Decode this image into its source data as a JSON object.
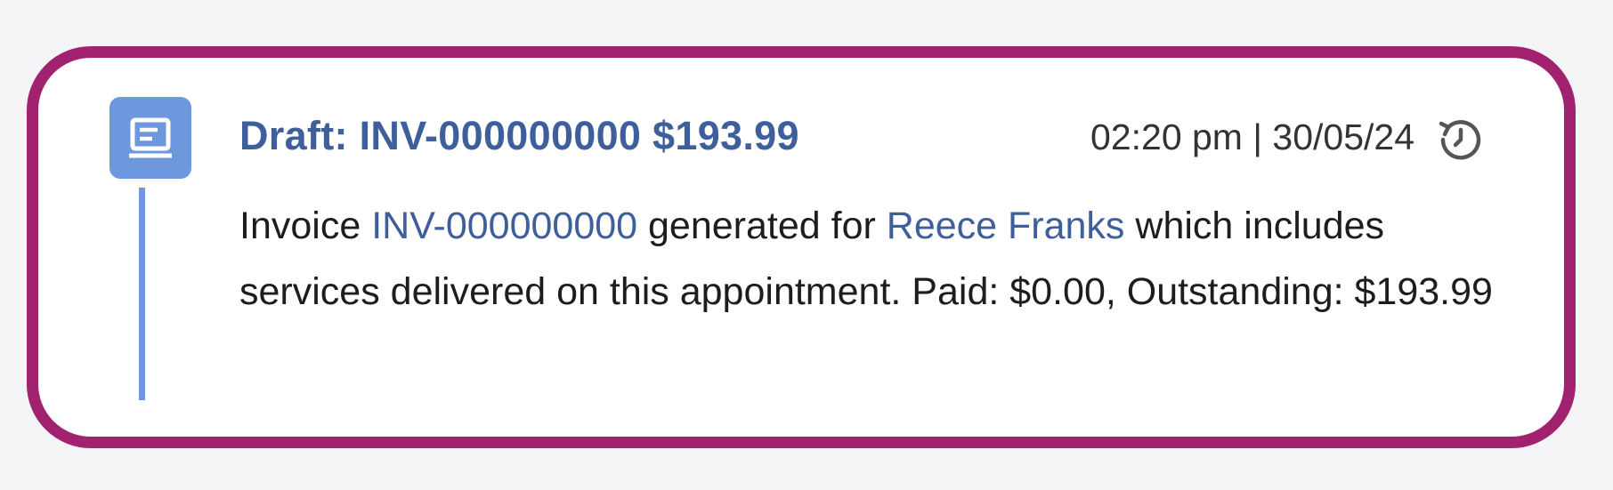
{
  "entry": {
    "icon": "invoice-icon",
    "title": "Draft: INV-000000000 $193.99",
    "timestamp": "02:20 pm | 30/05/24",
    "history_icon": "history-icon",
    "body": {
      "prefix": "Invoice ",
      "invoice_link": "INV-000000000",
      "middle": " generated for ",
      "client_link": "Reece Franks",
      "suffix": " which includes services delivered on this appointment. Paid: $0.00, Outstanding: $193.99"
    }
  },
  "colors": {
    "border": "#a1236f",
    "accent": "#6d98de",
    "title": "#3e5f9b"
  }
}
